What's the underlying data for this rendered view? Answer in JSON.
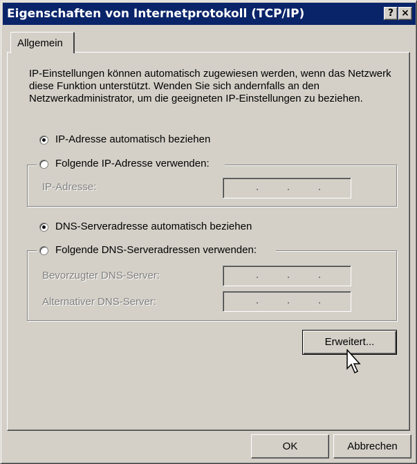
{
  "window": {
    "title": "Eigenschaften von Internetprotokoll (TCP/IP)",
    "help_label": "?",
    "close_label": "×"
  },
  "tabs": [
    {
      "label": "Allgemein",
      "selected": true
    }
  ],
  "description": "IP-Einstellungen können automatisch zugewiesen werden, wenn das Netzwerk diese Funktion unterstützt. Wenden Sie sich andernfalls an den Netzwerkadministrator, um die geeigneten IP-Einstellungen zu beziehen.",
  "ip": {
    "auto_label": "IP-Adresse automatisch beziehen",
    "auto_selected": true,
    "manual_label": "Folgende IP-Adresse verwenden:",
    "manual_selected": false,
    "address_label": "IP-Adresse:",
    "address_value": ""
  },
  "dns": {
    "auto_label": "DNS-Serveradresse automatisch beziehen",
    "auto_selected": true,
    "manual_label": "Folgende DNS-Serveradressen verwenden:",
    "manual_selected": false,
    "preferred_label": "Bevorzugter DNS-Server:",
    "preferred_value": "",
    "alternate_label": "Alternativer DNS-Server:",
    "alternate_value": ""
  },
  "buttons": {
    "advanced": "Erweitert...",
    "ok": "OK",
    "cancel": "Abbrechen"
  },
  "colors": {
    "titlebar": "#0a246a",
    "face": "#d4d0c8",
    "disabled_text": "#808080"
  }
}
